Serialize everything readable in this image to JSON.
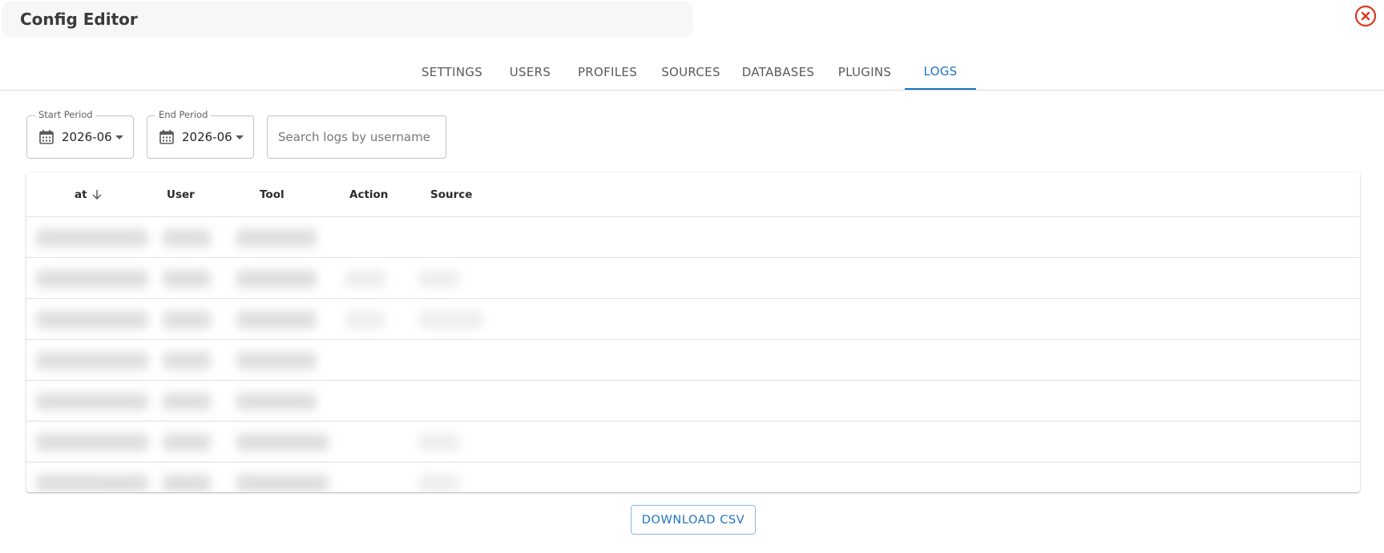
{
  "header": {
    "title": "Config Editor"
  },
  "tabs": [
    {
      "label": "SETTINGS"
    },
    {
      "label": "USERS"
    },
    {
      "label": "PROFILES"
    },
    {
      "label": "SOURCES"
    },
    {
      "label": "DATABASES"
    },
    {
      "label": "PLUGINS"
    },
    {
      "label": "LOGS",
      "active": true
    }
  ],
  "filters": {
    "start_period": {
      "legend": "Start Period",
      "value": "2026-06"
    },
    "end_period": {
      "legend": "End Period",
      "value": "2026-06"
    },
    "search": {
      "placeholder": "Search logs by username",
      "value": ""
    }
  },
  "table": {
    "columns": [
      {
        "label": "at",
        "sort": "descending"
      },
      {
        "label": "User"
      },
      {
        "label": "Tool"
      },
      {
        "label": "Action"
      },
      {
        "label": "Source"
      }
    ],
    "row_count": 7,
    "rows_obscured": true
  },
  "footer": {
    "download_label": "DOWNLOAD CSV"
  },
  "colors": {
    "accent": "#1e73be",
    "close": "#d9381e"
  },
  "icons": {
    "close": "close-circle-icon",
    "calendar": "calendar-icon",
    "dropdown": "caret-down-icon",
    "sort": "arrow-down-icon"
  }
}
